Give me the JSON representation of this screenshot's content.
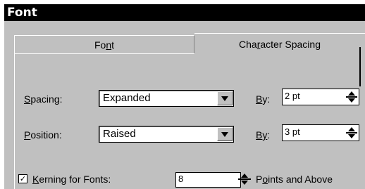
{
  "window": {
    "title": "Font"
  },
  "tabs": [
    {
      "label_pre": "Fo",
      "label_key": "n",
      "label_post": "t"
    },
    {
      "label_pre": "Cha",
      "label_key": "r",
      "label_post": "acter Spacing"
    }
  ],
  "spacing": {
    "label_key": "S",
    "label_rest": "pacing:",
    "value": "Expanded",
    "by_key": "B",
    "by_rest": "y:",
    "by_value": "2 pt"
  },
  "position": {
    "label_key": "P",
    "label_rest": "osition:",
    "value": "Raised",
    "by_key": "B",
    "by_mid": "y",
    "by_rest": ":",
    "by_value": "3 pt"
  },
  "kerning": {
    "checked": true,
    "check_mark": "✓",
    "label_key": "K",
    "label_rest": "erning for Fonts:",
    "value": "8",
    "after_pre": "P",
    "after_key": "o",
    "after_rest": "ints and Above"
  }
}
